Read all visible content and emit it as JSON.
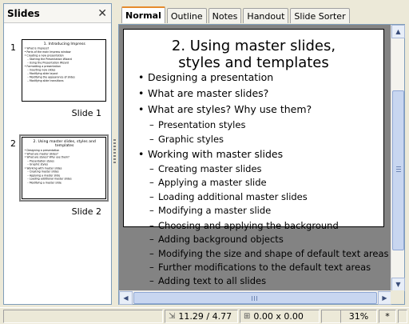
{
  "slides_pane": {
    "title": "Slides",
    "close_glyph": "✕",
    "thumbnails": [
      {
        "number": "1",
        "label": "Slide 1",
        "title": "1. Introducing Impress",
        "bullets": [
          {
            "text": "• What is Impress?",
            "level": 1
          },
          {
            "text": "• Parts of the main Impress window",
            "level": 1
          },
          {
            "text": "• Creating a new presentation",
            "level": 1
          },
          {
            "text": "– Starting the Presentation Wizard",
            "level": 2
          },
          {
            "text": "– Using the Presentation Wizard",
            "level": 2
          },
          {
            "text": "• Formatting a presentation",
            "level": 1
          },
          {
            "text": "– Inserting new slides",
            "level": 2
          },
          {
            "text": "– Modifying slide layout",
            "level": 2
          },
          {
            "text": "– Modifying the appearance of slides",
            "level": 2
          },
          {
            "text": "– Modifying slide transitions",
            "level": 2
          }
        ]
      },
      {
        "number": "2",
        "label": "Slide 2",
        "title": "2. Using master slides, styles and templates",
        "bullets": [
          {
            "text": "• Designing a presentation",
            "level": 1
          },
          {
            "text": "• What are master slides?",
            "level": 1
          },
          {
            "text": "• What are styles? Why use them?",
            "level": 1
          },
          {
            "text": "– Presentation styles",
            "level": 2
          },
          {
            "text": "– Graphic styles",
            "level": 2
          },
          {
            "text": "• Working with master slides",
            "level": 1
          },
          {
            "text": "– Creating master slides",
            "level": 2
          },
          {
            "text": "– Applying a master slide",
            "level": 2
          },
          {
            "text": "– Loading additional master slides",
            "level": 2
          },
          {
            "text": "– Modifying a master slide",
            "level": 2
          }
        ]
      }
    ]
  },
  "tabs": [
    "Normal",
    "Outline",
    "Notes",
    "Handout",
    "Slide Sorter"
  ],
  "active_tab": "Normal",
  "slide": {
    "title_line1": "2. Using master slides,",
    "title_line2": "styles and templates",
    "bullets": [
      {
        "text": "Designing a presentation",
        "level": 1,
        "marker": "•"
      },
      {
        "text": "What are master slides?",
        "level": 1,
        "marker": "•"
      },
      {
        "text": "What are styles? Why use them?",
        "level": 1,
        "marker": "•"
      },
      {
        "text": "Presentation styles",
        "level": 2,
        "marker": "–"
      },
      {
        "text": "Graphic styles",
        "level": 2,
        "marker": "–"
      },
      {
        "text": "Working with master slides",
        "level": 1,
        "marker": "•"
      },
      {
        "text": "Creating master slides",
        "level": 2,
        "marker": "–"
      },
      {
        "text": "Applying a master slide",
        "level": 2,
        "marker": "–"
      },
      {
        "text": "Loading additional master slides",
        "level": 2,
        "marker": "–"
      },
      {
        "text": "Modifying a master slide",
        "level": 2,
        "marker": "–"
      },
      {
        "text": "Choosing and applying the background",
        "level": 2,
        "marker": "–"
      },
      {
        "text": "Adding background objects",
        "level": 2,
        "marker": "–"
      },
      {
        "text": "Modifying the size and shape of default text areas",
        "level": 2,
        "marker": "–"
      },
      {
        "text": "Further modifications to the default text areas",
        "level": 2,
        "marker": "–"
      },
      {
        "text": "Adding text to all slides",
        "level": 2,
        "marker": "–"
      }
    ]
  },
  "status_bar": {
    "position": "11.29 / 4.77",
    "size": "0.00 x 0.00",
    "zoom": "31%",
    "modified": "*"
  },
  "colors": {
    "active_tab_accent": "#e68b2c",
    "workspace_gray": "#838383",
    "scrollbar_thumb": "#c8d6f0"
  }
}
